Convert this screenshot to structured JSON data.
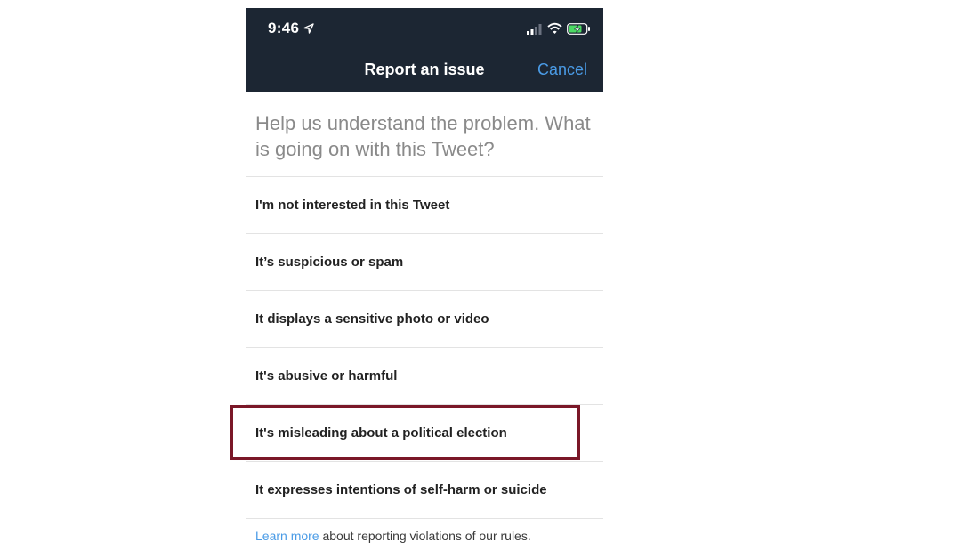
{
  "status_bar": {
    "time": "9:46"
  },
  "header": {
    "title": "Report an issue",
    "cancel_label": "Cancel"
  },
  "prompt": "Help us understand the problem. What is going on with this Tweet?",
  "options": [
    {
      "label": "I'm not interested in this Tweet"
    },
    {
      "label": "It’s suspicious or spam"
    },
    {
      "label": "It displays a sensitive photo or video"
    },
    {
      "label": "It's abusive or harmful"
    },
    {
      "label": "It's misleading about a political election"
    },
    {
      "label": "It expresses intentions of self-harm or suicide"
    }
  ],
  "footer": {
    "link_text": "Learn more",
    "rest_text": " about reporting violations of our rules."
  },
  "colors": {
    "header_bg": "#1c2633",
    "accent": "#4a9be6",
    "highlight_border": "#7a1728"
  }
}
